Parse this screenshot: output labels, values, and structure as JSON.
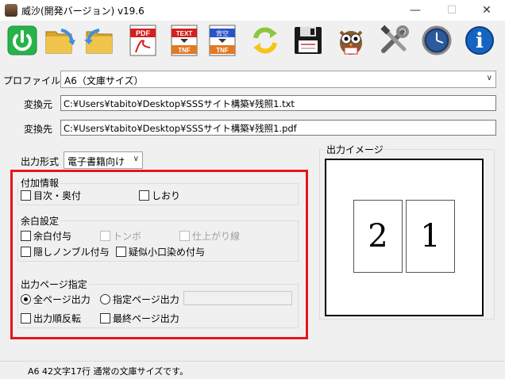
{
  "window": {
    "title": "威沙(開発バージョン) v19.6",
    "min_label": "—",
    "max_label": "☐",
    "close_label": "✕"
  },
  "toolbar": {
    "items": [
      {
        "name": "power-button",
        "icon": "power-icon"
      },
      {
        "name": "open-folder-button",
        "icon": "folder-arrow-icon"
      },
      {
        "name": "save-folder-button",
        "icon": "folder-return-icon"
      },
      {
        "name": "pdf-button",
        "icon": "pdf-icon",
        "label": "PDF"
      },
      {
        "name": "text-to-tnf-button",
        "icon": "text-tnf-icon",
        "label_top": "TEXT",
        "label_bottom": "TNF"
      },
      {
        "name": "blank-to-tnf-button",
        "icon": "blank-tnf-icon",
        "label_top": "背空",
        "label_bottom": "TNF"
      },
      {
        "name": "refresh-button",
        "icon": "refresh-icon"
      },
      {
        "name": "save-button",
        "icon": "floppy-icon"
      },
      {
        "name": "owl-button",
        "icon": "owl-icon"
      },
      {
        "name": "tools-button",
        "icon": "tools-icon"
      },
      {
        "name": "clock-button",
        "icon": "clock-icon"
      },
      {
        "name": "info-button",
        "icon": "info-icon",
        "label": "i"
      }
    ]
  },
  "profile": {
    "label": "プロファイル",
    "value": "A6（文庫サイズ）"
  },
  "source": {
    "label": "変換元",
    "value": "C:¥Users¥tabito¥Desktop¥SSSサイト構築¥残照1.txt"
  },
  "destination": {
    "label": "変換先",
    "value": "C:¥Users¥tabito¥Desktop¥SSSサイト構築¥残照1.pdf"
  },
  "output_format": {
    "label": "出力形式",
    "value": "電子書籍向け"
  },
  "additional_info": {
    "title": "付加情報",
    "toc": "目次・奥付",
    "bookmark": "しおり"
  },
  "margin_settings": {
    "title": "余白設定",
    "add_margin": "余白付与",
    "crop_marks": "トンボ",
    "finish_line": "仕上がり線",
    "hidden_nombre": "隠しノンブル付与",
    "pseudo_edge": "疑似小口染め付与"
  },
  "output_pages": {
    "title": "出力ページ指定",
    "all_pages": "全ページ出力",
    "specified_pages": "指定ページ出力",
    "page_range": "",
    "reverse_order": "出力順反転",
    "last_page": "最終ページ出力"
  },
  "preview": {
    "title": "出力イメージ",
    "left_page": "2",
    "right_page": "1"
  },
  "status": {
    "text": "A6 42文字17行 通常の文庫サイズです。"
  }
}
